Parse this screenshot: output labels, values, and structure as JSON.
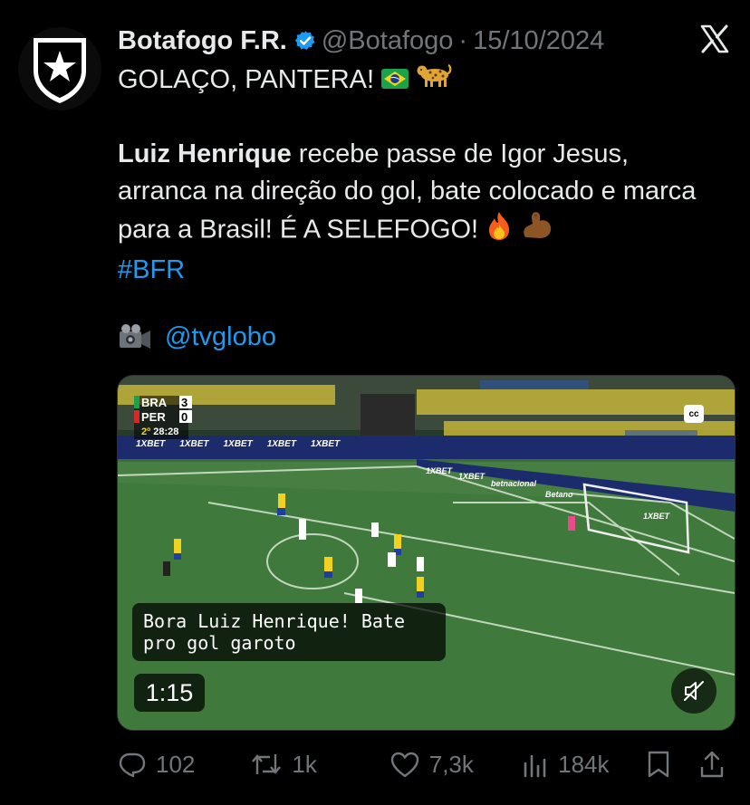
{
  "tweet": {
    "author_name": "Botafogo F.R.",
    "handle": "@Botafogo",
    "separator": "·",
    "date": "15/10/2024",
    "line1": "GOLAÇO, PANTERA!",
    "player_name": "Luiz Henrique",
    "body_rest": " recebe passe de Igor Jesus, arranca na direção do gol, bate colocado e marca para a Brasil! É A SELEFOGO!",
    "hashtag": "#BFR",
    "media_credit": "@tvglobo",
    "icons": {
      "avatar": "botafogo-star-shield-icon",
      "verified": "verified-badge-icon",
      "x": "x-logo-icon",
      "flag": "brazil-flag-emoji",
      "leopard": "leopard-emoji",
      "fire": "fire-emoji",
      "muscle": "flexed-biceps-emoji",
      "camera": "video-camera-emoji"
    },
    "colors": {
      "link": "#1d9bf0",
      "text": "#e7e9ea",
      "muted": "#71767b",
      "verified": "#1d9bf0"
    }
  },
  "video": {
    "scoreboard": {
      "team1": "BRA",
      "score1": "3",
      "team2": "PER",
      "score2": "0",
      "half": "2º",
      "clock": "28:28"
    },
    "cc_label": "cc",
    "caption": "Bora Luiz Henrique! Bate pro gol garoto",
    "duration": "1:15",
    "ad_boards": [
      "1XBET",
      "1XBET",
      "1XBET",
      "1XBET",
      "1XBET",
      "1XBET",
      "1XBET",
      "betnacional",
      "Betano",
      "1XBET"
    ],
    "icons": {
      "mute": "muted-speaker-icon"
    }
  },
  "actions": {
    "replies": "102",
    "reposts": "1k",
    "likes": "7,3k",
    "views": "184k",
    "icons": {
      "reply": "reply-bubble-icon",
      "repost": "repost-arrows-icon",
      "like": "heart-icon",
      "views": "views-bars-icon",
      "bookmark": "bookmark-icon",
      "share": "share-icon"
    }
  }
}
